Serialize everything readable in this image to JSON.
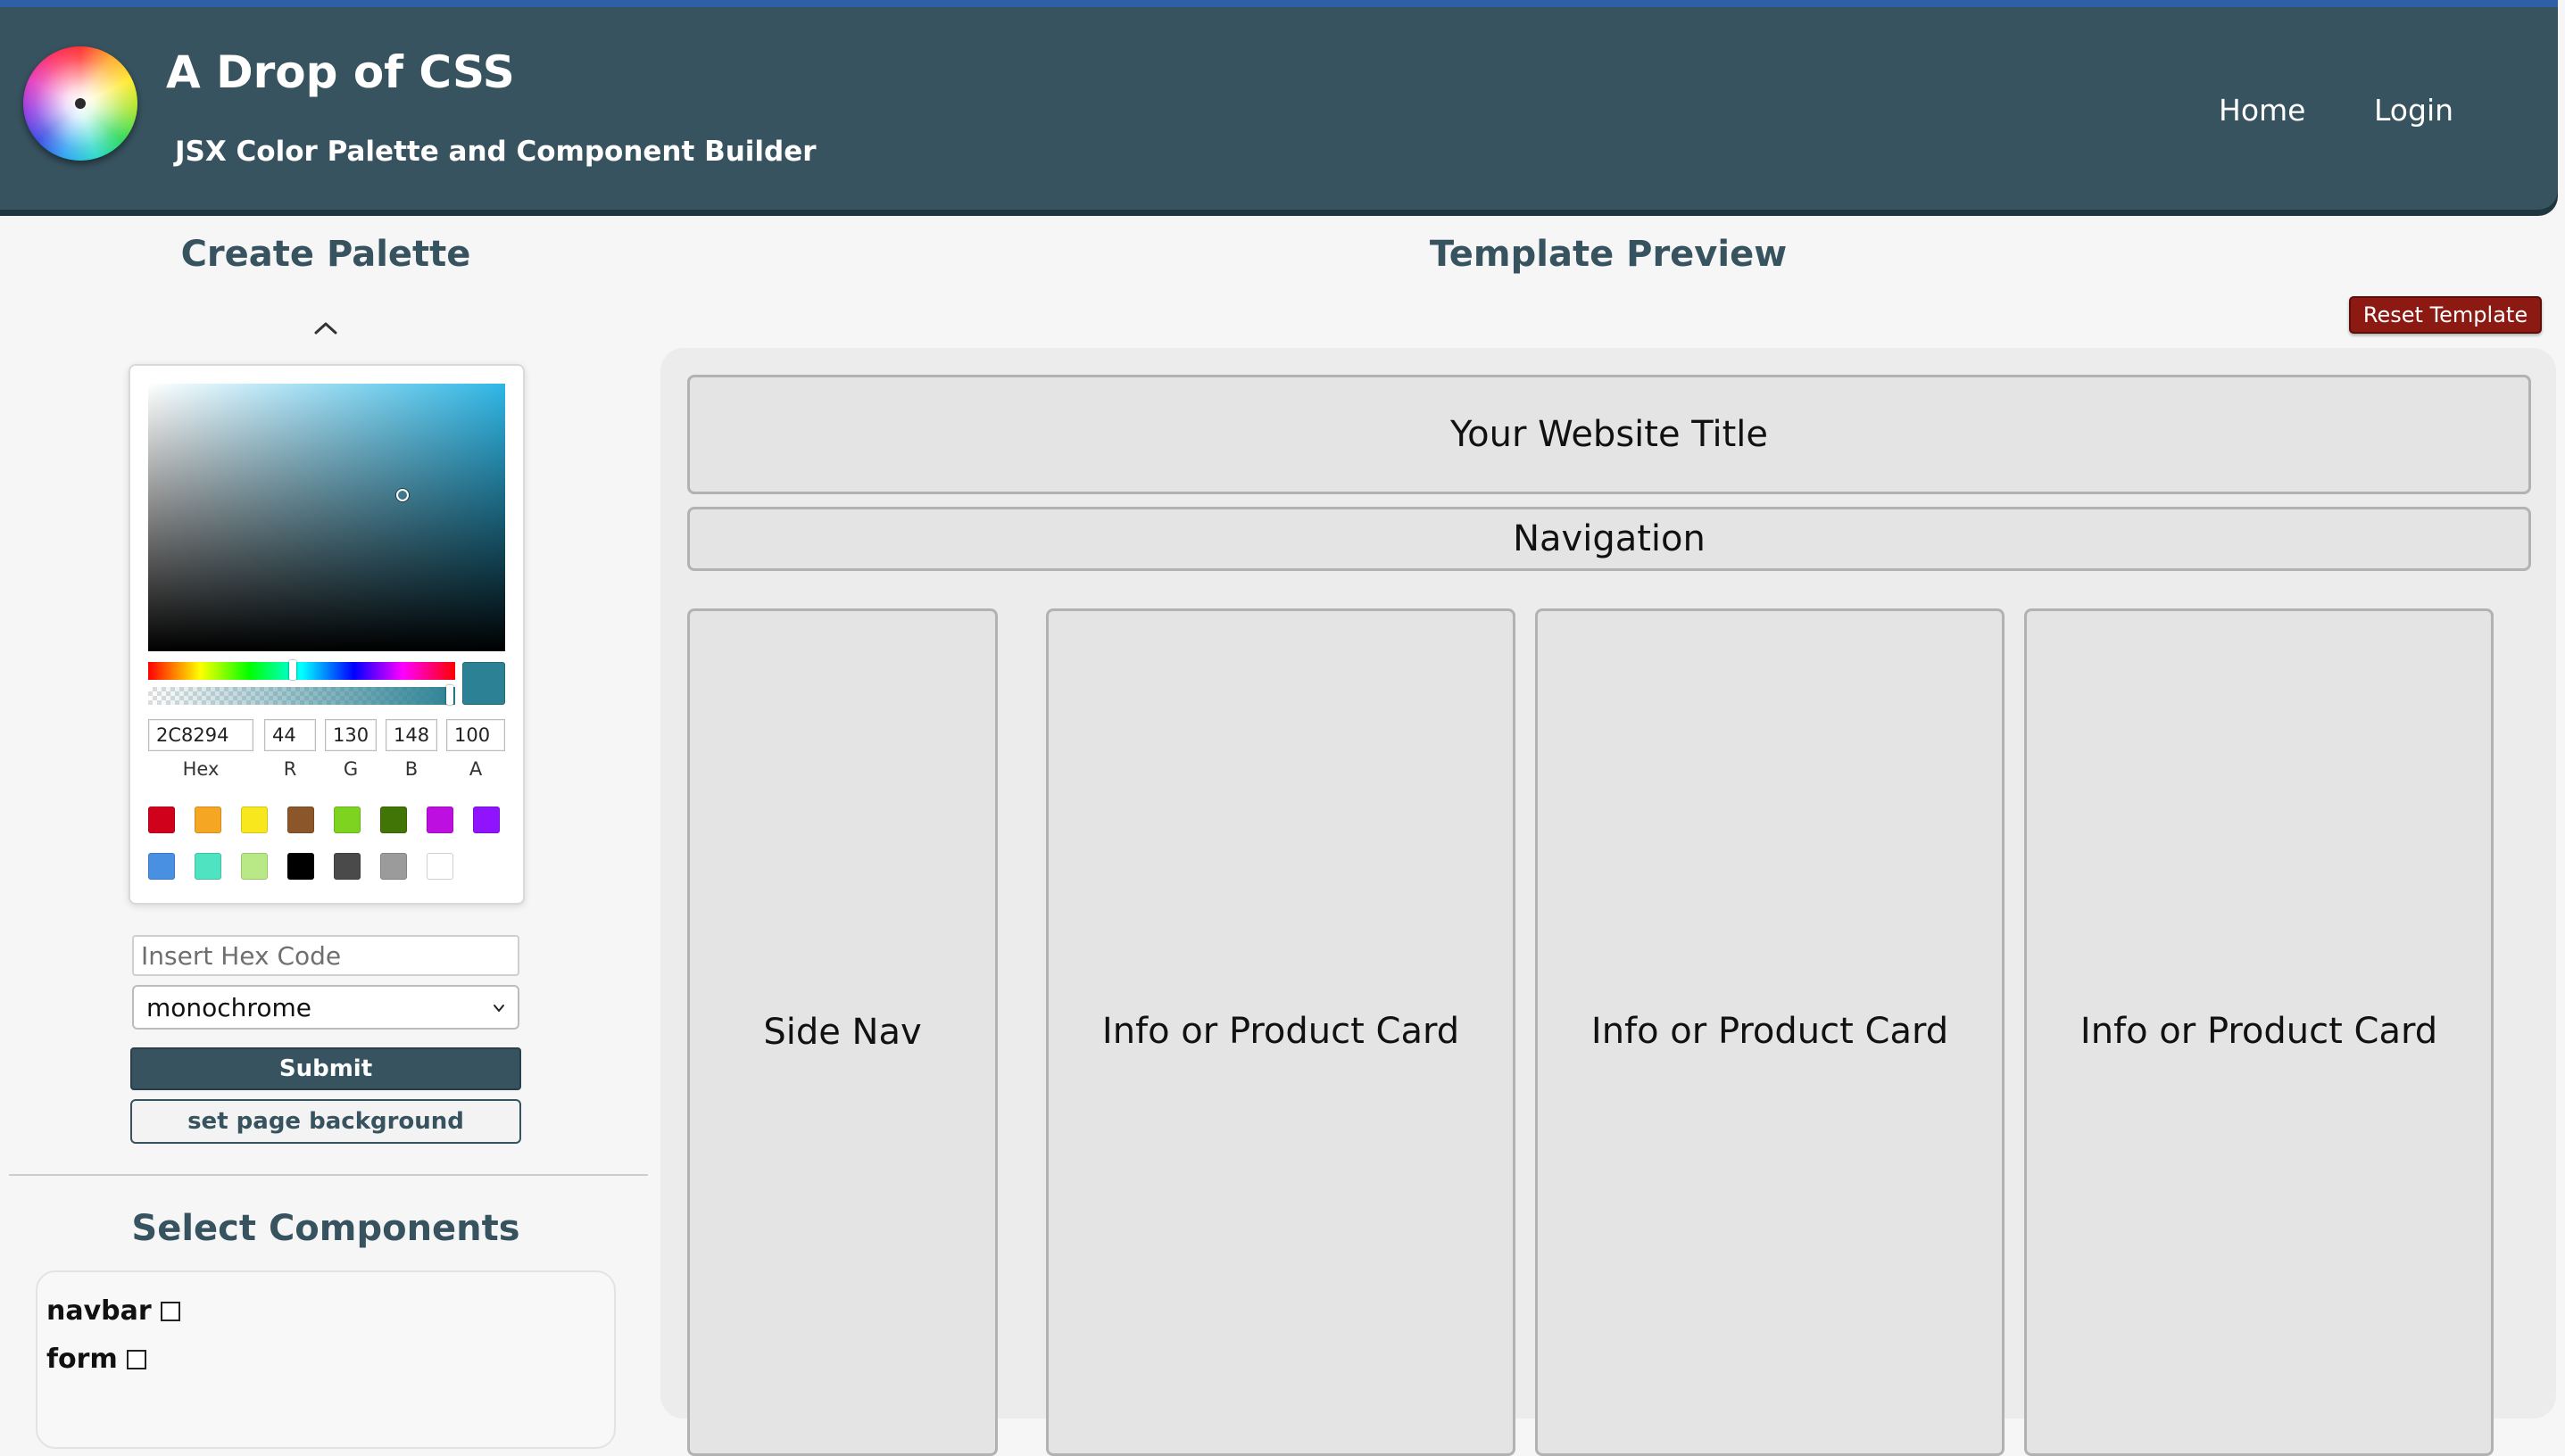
{
  "header": {
    "logo_icon": "color-wheel-icon",
    "title": "A Drop of CSS",
    "subtitle": "JSX Color Palette and Component Builder",
    "nav": {
      "home": "Home",
      "login": "Login"
    }
  },
  "colors": {
    "header_bg": "#37535f",
    "header_top_border": "#2f5fa5",
    "heading_text": "#37535f",
    "reset_button": "#8c1a12",
    "selected_color": "#2c8294"
  },
  "palette": {
    "heading": "Create Palette",
    "collapse_icon": "chevron-up-icon",
    "picker": {
      "hex": "2C8294",
      "r": "44",
      "g": "130",
      "b": "148",
      "a": "100",
      "labels": {
        "hex": "Hex",
        "r": "R",
        "g": "G",
        "b": "B",
        "a": "A"
      },
      "preset_swatches": [
        "#d0021b",
        "#f5a623",
        "#f8e71c",
        "#8b572a",
        "#7ed321",
        "#417505",
        "#bd10e0",
        "#9013fe",
        "#4a90e2",
        "#50e3c2",
        "#b8e986",
        "#000000",
        "#4a4a4a",
        "#9b9b9b",
        "#ffffff"
      ]
    },
    "hex_placeholder": "Insert Hex Code",
    "mode_selected": "monochrome",
    "submit_label": "Submit",
    "page_bg_label": "set page background"
  },
  "components": {
    "heading": "Select Components",
    "items": [
      {
        "label": "navbar",
        "checked": false
      },
      {
        "label": "form",
        "checked": false
      }
    ]
  },
  "preview": {
    "heading": "Template Preview",
    "reset_label": "Reset Template",
    "title_block": "Your Website Title",
    "nav_block": "Navigation",
    "side_nav": "Side Nav",
    "cards": [
      "Info or Product Card",
      "Info or Product Card",
      "Info or Product Card"
    ]
  }
}
